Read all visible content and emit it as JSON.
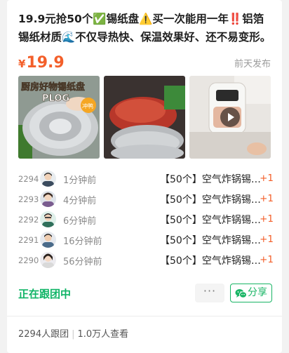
{
  "post": {
    "title": "19.9元抢50个✅锡纸盘⚠️买一次能用一年‼️铝箔锡纸材质🌊不仅导热快、保温效果好、还不易变形。",
    "price_symbol": "¥",
    "price_value": "19.9",
    "posted": "前天发布",
    "thumb1_overlay_line1": "厨房好物锡纸盘",
    "thumb1_overlay_line2": "PLOG",
    "thumb1_badge": "冲鸭"
  },
  "group_list": [
    {
      "num": "2294",
      "time": "1分钟前",
      "item": "【50个】空气炸锅锡纸盘",
      "plus": "+1"
    },
    {
      "num": "2293",
      "time": "4分钟前",
      "item": "【50个】空气炸锅锡纸盘",
      "plus": "+1"
    },
    {
      "num": "2292",
      "time": "6分钟前",
      "item": "【50个】空气炸锅锡纸盘",
      "plus": "+1"
    },
    {
      "num": "2291",
      "time": "16分钟前",
      "item": "【50个】空气炸锅锡纸盘",
      "plus": "+1"
    },
    {
      "num": "2290",
      "time": "56分钟前",
      "item": "【50个】空气炸锅锡纸盘",
      "plus": "+1"
    }
  ],
  "actions": {
    "following": "正在跟团中",
    "more": "···",
    "share": "分享"
  },
  "stats": {
    "joined": "2294人跟团",
    "sep": "|",
    "views": "1.0万人查看"
  },
  "colors": {
    "price": "#f35f2a",
    "green": "#0fb466"
  },
  "icons": [
    "play-icon",
    "wechat-icon"
  ]
}
